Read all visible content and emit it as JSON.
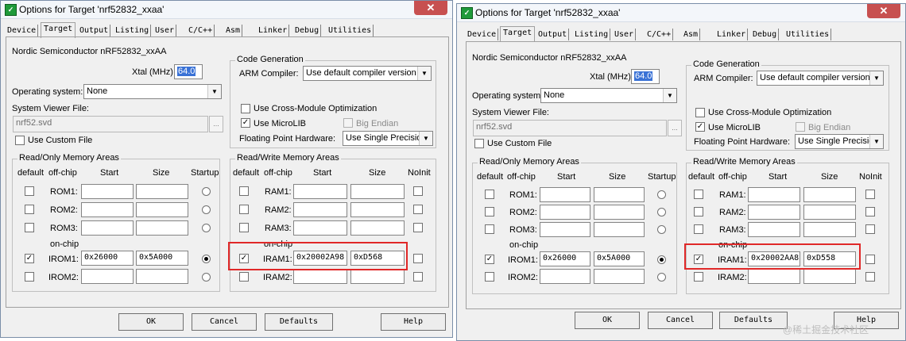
{
  "left": {
    "title": "Options for Target 'nrf52832_xxaa'",
    "tabs": [
      "Device",
      "Target",
      "Output",
      "Listing",
      "User",
      "C/C++",
      "Asm",
      "Linker",
      "Debug",
      "Utilities"
    ],
    "active_tab": "Target",
    "device_name": "Nordic Semiconductor nRF52832_xxAA",
    "xtal_label": "Xtal (MHz):",
    "xtal_value": "64.0",
    "os_label": "Operating system:",
    "os_value": "None",
    "svf_label": "System Viewer File:",
    "svf_value": "nrf52.svd",
    "custom_file_label": "Use Custom File",
    "codegen": {
      "title": "Code Generation",
      "compiler_label": "ARM Compiler:",
      "compiler_value": "Use default compiler version",
      "cross_module_label": "Use Cross-Module Optimization",
      "microlib_label": "Use MicroLIB",
      "big_endian_label": "Big Endian",
      "fp_label": "Floating Point Hardware:",
      "fp_value": "Use Single Precision"
    },
    "ro": {
      "title": "Read/Only Memory Areas",
      "h_default": "default",
      "h_offchip": "off-chip",
      "h_start": "Start",
      "h_size": "Size",
      "h_startup": "Startup",
      "onchip": "on-chip",
      "rows": [
        {
          "label": "ROM1:",
          "start": "",
          "size": "",
          "default": false,
          "startup": false
        },
        {
          "label": "ROM2:",
          "start": "",
          "size": "",
          "default": false,
          "startup": false
        },
        {
          "label": "ROM3:",
          "start": "",
          "size": "",
          "default": false,
          "startup": false
        },
        {
          "label": "IROM1:",
          "start": "0x26000",
          "size": "0x5A000",
          "default": true,
          "startup": true
        },
        {
          "label": "IROM2:",
          "start": "",
          "size": "",
          "default": false,
          "startup": false
        }
      ]
    },
    "rw": {
      "title": "Read/Write Memory Areas",
      "h_default": "default",
      "h_offchip": "off-chip",
      "h_start": "Start",
      "h_size": "Size",
      "h_noinit": "NoInit",
      "onchip": "on-chip",
      "rows": [
        {
          "label": "RAM1:",
          "start": "",
          "size": "",
          "default": false,
          "noinit": false
        },
        {
          "label": "RAM2:",
          "start": "",
          "size": "",
          "default": false,
          "noinit": false
        },
        {
          "label": "RAM3:",
          "start": "",
          "size": "",
          "default": false,
          "noinit": false
        },
        {
          "label": "IRAM1:",
          "start": "0x20002A98",
          "size": "0xD568",
          "default": true,
          "noinit": false
        },
        {
          "label": "IRAM2:",
          "start": "",
          "size": "",
          "default": false,
          "noinit": false
        }
      ]
    },
    "buttons": {
      "ok": "OK",
      "cancel": "Cancel",
      "defaults": "Defaults",
      "help": "Help"
    }
  },
  "right": {
    "title": "Options for Target 'nrf52832_xxaa'",
    "tabs": [
      "Device",
      "Target",
      "Output",
      "Listing",
      "User",
      "C/C++",
      "Asm",
      "Linker",
      "Debug",
      "Utilities"
    ],
    "active_tab": "Target",
    "device_name": "Nordic Semiconductor nRF52832_xxAA",
    "xtal_label": "Xtal (MHz):",
    "xtal_value": "64.0",
    "os_label": "Operating system:",
    "os_value": "None",
    "svf_label": "System Viewer File:",
    "svf_value": "nrf52.svd",
    "custom_file_label": "Use Custom File",
    "codegen": {
      "title": "Code Generation",
      "compiler_label": "ARM Compiler:",
      "compiler_value": "Use default compiler version",
      "cross_module_label": "Use Cross-Module Optimization",
      "microlib_label": "Use MicroLIB",
      "big_endian_label": "Big Endian",
      "fp_label": "Floating Point Hardware:",
      "fp_value": "Use Single Precision"
    },
    "ro": {
      "title": "Read/Only Memory Areas",
      "h_default": "default",
      "h_offchip": "off-chip",
      "h_start": "Start",
      "h_size": "Size",
      "h_startup": "Startup",
      "onchip": "on-chip",
      "rows": [
        {
          "label": "ROM1:",
          "start": "",
          "size": "",
          "default": false,
          "startup": false
        },
        {
          "label": "ROM2:",
          "start": "",
          "size": "",
          "default": false,
          "startup": false
        },
        {
          "label": "ROM3:",
          "start": "",
          "size": "",
          "default": false,
          "startup": false
        },
        {
          "label": "IROM1:",
          "start": "0x26000",
          "size": "0x5A000",
          "default": true,
          "startup": true
        },
        {
          "label": "IROM2:",
          "start": "",
          "size": "",
          "default": false,
          "startup": false
        }
      ]
    },
    "rw": {
      "title": "Read/Write Memory Areas",
      "h_default": "default",
      "h_offchip": "off-chip",
      "h_start": "Start",
      "h_size": "Size",
      "h_noinit": "NoInit",
      "onchip": "on-chip",
      "rows": [
        {
          "label": "RAM1:",
          "start": "",
          "size": "",
          "default": false,
          "noinit": false
        },
        {
          "label": "RAM2:",
          "start": "",
          "size": "",
          "default": false,
          "noinit": false
        },
        {
          "label": "RAM3:",
          "start": "",
          "size": "",
          "default": false,
          "noinit": false
        },
        {
          "label": "IRAM1:",
          "start": "0x20002AA8",
          "size": "0xD558",
          "default": true,
          "noinit": false
        },
        {
          "label": "IRAM2:",
          "start": "",
          "size": "",
          "default": false,
          "noinit": false
        }
      ]
    },
    "buttons": {
      "ok": "OK",
      "cancel": "Cancel",
      "defaults": "Defaults",
      "help": "Help"
    }
  },
  "watermark": "@稀土掘金技术社区",
  "colors": {
    "highlight_box": "#e02828",
    "selection": "#3a72d6",
    "titlebar_close": "#c75050"
  }
}
